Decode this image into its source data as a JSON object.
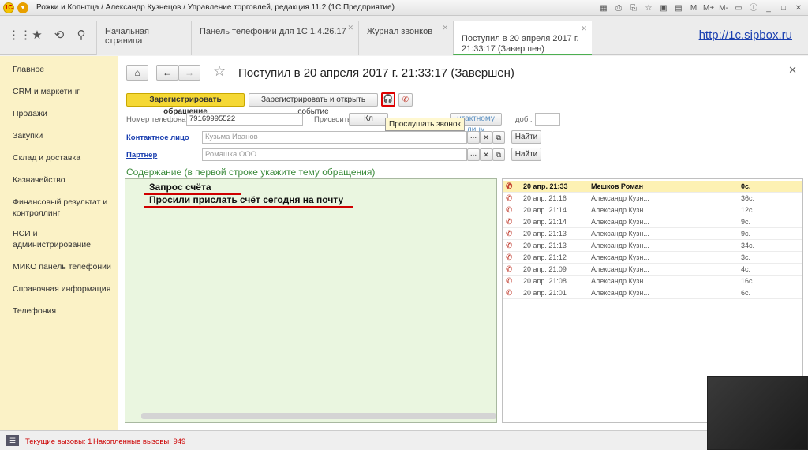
{
  "window": {
    "title": "Рожки и Копытца / Александр Кузнецов / Управление торговлей, редакция 11.2  (1С:Предприятие)"
  },
  "tabs": [
    {
      "label": "Начальная страница"
    },
    {
      "label": "Панель телефонии для 1С 1.4.26.17"
    },
    {
      "label": "Журнал звонков"
    },
    {
      "label": "Поступил в 20 апреля 2017 г.\n21:33:17 (Завершен)"
    }
  ],
  "site_link": "http://1c.sipbox.ru",
  "nav": {
    "items": [
      "Главное",
      "CRM и маркетинг",
      "Продажи",
      "Закупки",
      "Склад и доставка",
      "Казначейство",
      "Финансовый результат и контроллинг",
      "НСИ и администрирование",
      "МИКО панель телефонии",
      "Справочная информация",
      "Телефония"
    ]
  },
  "form": {
    "title": "Поступил в 20 апреля 2017 г. 21:33:17 (Завершен)",
    "btn_register": "Зарегистрировать обращение",
    "btn_register_open": "Зарегистрировать и открыть событие",
    "phone_label": "Номер телефона:",
    "phone_value": "79169995522",
    "assign_label": "Присвоить:",
    "assign_btn1": "Кл",
    "assign_btn2": "нтактному лицу",
    "ext_label": "доб.:",
    "contact_label": "Контактное лицо",
    "contact_value": "Кузьма Иванов",
    "partner_label": "Партнер",
    "partner_value": "Ромашка ООО",
    "find_label": "Найти",
    "dots": "...",
    "tooltip": "Прослушать звонок",
    "content_title": "Содержание (в первой строке укажите тему обращения)",
    "content_lines": [
      "Запрос счёта",
      "Просили прислать счёт сегодня на почту"
    ]
  },
  "calls": [
    {
      "date": "20 апр. 21:33",
      "name": "Мешков Роман",
      "dur": "0с."
    },
    {
      "date": "20 апр. 21:16",
      "name": "Александр Кузн...",
      "dur": "36с."
    },
    {
      "date": "20 апр. 21:14",
      "name": "Александр Кузн...",
      "dur": "12с."
    },
    {
      "date": "20 апр. 21:14",
      "name": "Александр Кузн...",
      "dur": "9с."
    },
    {
      "date": "20 апр. 21:13",
      "name": "Александр Кузн...",
      "dur": "9с."
    },
    {
      "date": "20 апр. 21:13",
      "name": "Александр Кузн...",
      "dur": "34с."
    },
    {
      "date": "20 апр. 21:12",
      "name": "Александр Кузн...",
      "dur": "3с."
    },
    {
      "date": "20 апр. 21:09",
      "name": "Александр Кузн...",
      "dur": "4с."
    },
    {
      "date": "20 апр. 21:08",
      "name": "Александр Кузн...",
      "dur": "16с."
    },
    {
      "date": "20 апр. 21:01",
      "name": "Александр Кузн...",
      "dur": "6с."
    }
  ],
  "status": {
    "current": "Текущие вызовы: 1",
    "accumulated": "Накопленные вызовы: 949"
  }
}
